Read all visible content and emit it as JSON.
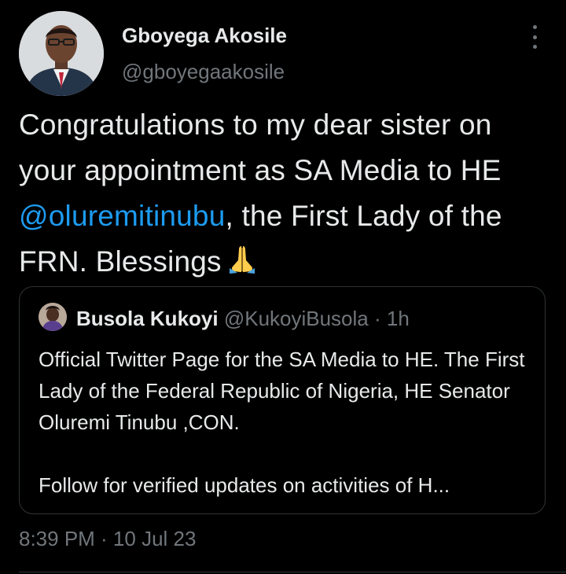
{
  "author": {
    "name": "Gboyega Akosile",
    "handle": "@gboyegaakosile",
    "avatar": "author-avatar-photo"
  },
  "tweet": {
    "text_before": "Congratulations to my dear sister on your appointment as SA Media to HE ",
    "mention": "@oluremitinubu",
    "text_after": ", the First Lady of the FRN. Blessings",
    "emoji": "folded-hands-icon",
    "timestamp": "8:39 PM · 10 Jul 23"
  },
  "quoted_tweet": {
    "name": "Busola Kukoyi",
    "handle": "@KukoyiBusola",
    "separator": "·",
    "time": "1h",
    "text": "Official Twitter Page for the SA Media to HE. The First Lady of the Federal Republic of Nigeria, HE Senator Oluremi Tinubu ,CON.\n\nFollow for verified updates on activities of H..."
  },
  "menu": {
    "icon": "more-options-icon"
  },
  "colors": {
    "background": "#000000",
    "text": "#e7e9ea",
    "secondary": "#71767b",
    "link": "#1d9bf0",
    "border": "#2f3336"
  }
}
